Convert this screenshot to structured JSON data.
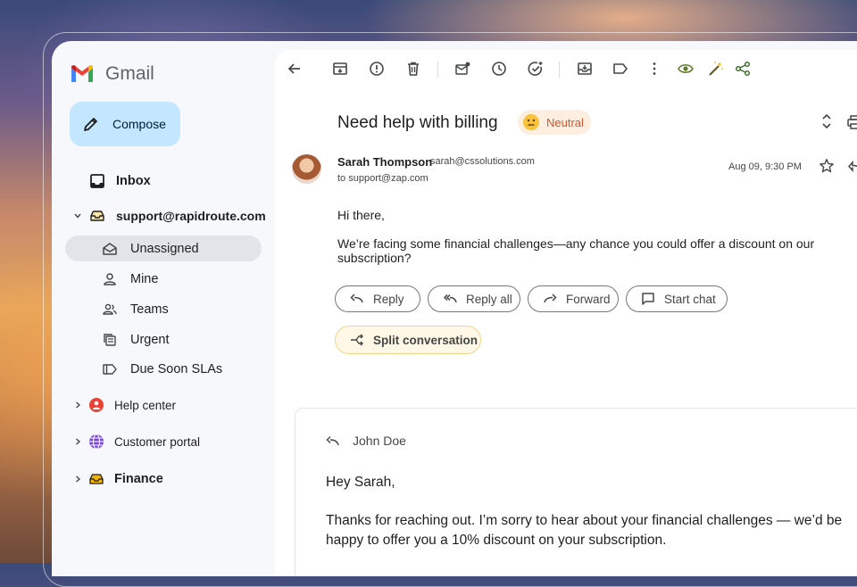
{
  "app": {
    "name": "Gmail",
    "brand_colors": {
      "red": "#ea4335",
      "blue": "#4285f4",
      "green": "#34a853",
      "yellow": "#fbbc04"
    }
  },
  "compose": {
    "label": "Compose",
    "icon": "pencil-icon"
  },
  "sidebar": {
    "inbox": {
      "label": "Inbox",
      "icon": "inbox-icon"
    },
    "account": {
      "label": "support@rapidroute.com",
      "icon": "inbox-tray-icon"
    },
    "items": [
      {
        "label": "Unassigned",
        "icon": "envelope-open-icon",
        "active": true
      },
      {
        "label": "Mine",
        "icon": "person-icon"
      },
      {
        "label": "Teams",
        "icon": "people-icon"
      },
      {
        "label": "Urgent",
        "icon": "stack-icon"
      },
      {
        "label": "Due Soon SLAs",
        "icon": "label-icon"
      }
    ],
    "groups": [
      {
        "label": "Help center",
        "icon": "lifebuoy-icon",
        "color": "#ea4335"
      },
      {
        "label": "Customer portal",
        "icon": "globe-icon",
        "color": "#7b4ad8"
      },
      {
        "label": "Finance",
        "icon": "inbox-tray-icon",
        "color": "#f5b400"
      }
    ]
  },
  "toolbar": {
    "icons": [
      "back-arrow-icon",
      "archive-icon",
      "report-icon",
      "delete-icon",
      "mark-unread-icon",
      "snooze-icon",
      "add-task-icon",
      "move-to-icon",
      "label-icon",
      "more-icon",
      "eye-icon",
      "magic-wand-icon",
      "share-icon"
    ]
  },
  "email": {
    "subject": "Need help with billing",
    "sentiment": "Neutral",
    "sender_name": "Sarah Thompson",
    "sender_email": "sarah@cssolutions.com",
    "to": "to support@zap.com",
    "date": "Aug 09, 9:30 PM",
    "body": [
      "Hi there,",
      "We’re facing some financial challenges—any chance you could offer a discount on our",
      "subscription?"
    ]
  },
  "actions": {
    "reply": "Reply",
    "reply_all": "Reply all",
    "forward": "Forward",
    "start_chat": "Start chat",
    "split": "Split conversation"
  },
  "reply_draft": {
    "author": "John Doe",
    "lines": [
      "Hey Sarah,",
      "Thanks for reaching out. I’m sorry to hear about your financial challenges — we’d be",
      "happy to offer you a 10% discount on your subscription."
    ]
  }
}
